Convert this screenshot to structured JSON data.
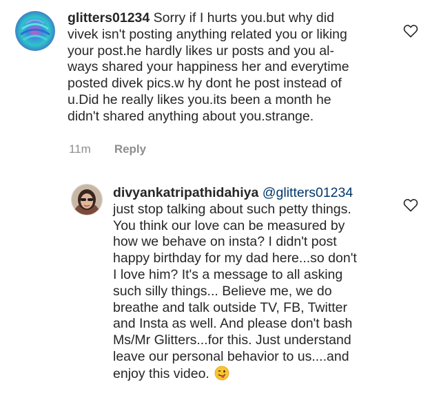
{
  "comments": [
    {
      "username": "glitters01234",
      "mention": "",
      "text": "Sorry  if I hurts you.but why did\nvivek isn't posting anything related you or liking\nyour post.he hardly likes ur posts and you al-\nways shared your happiness her and everytime\nposted divek pics.w hy dont he post instead of\nu.Did he really likes you.its been a month he\ndidn't shared anything about you.strange.",
      "time": "11m",
      "reply_label": "Reply",
      "avatar_icon": "swirl-avatar",
      "like_icon": "heart-outline-icon"
    },
    {
      "username": "divyankatripathidahiya",
      "mention": "@glitters01234",
      "text": "just stop talking about such petty things.\nYou think our love can be measured by\nhow we behave on insta? I didn't post\nhappy birthday for my dad here...so don't\nI love him? It's a message to all asking\nsuch silly things... Believe me, we do\nbreathe and talk outside TV, FB, Twitter\nand Insta as well. And please don't bash\nMs/Mr Glitters...for this. Just understand\nleave our personal behavior to us....and\nenjoy this video.",
      "emoji": "winking-face-tongue-emoji",
      "avatar_icon": "profile-photo-avatar",
      "like_icon": "heart-outline-icon"
    }
  ],
  "colors": {
    "text": "#262626",
    "meta": "#8e8e8e",
    "mention": "#00376b"
  }
}
